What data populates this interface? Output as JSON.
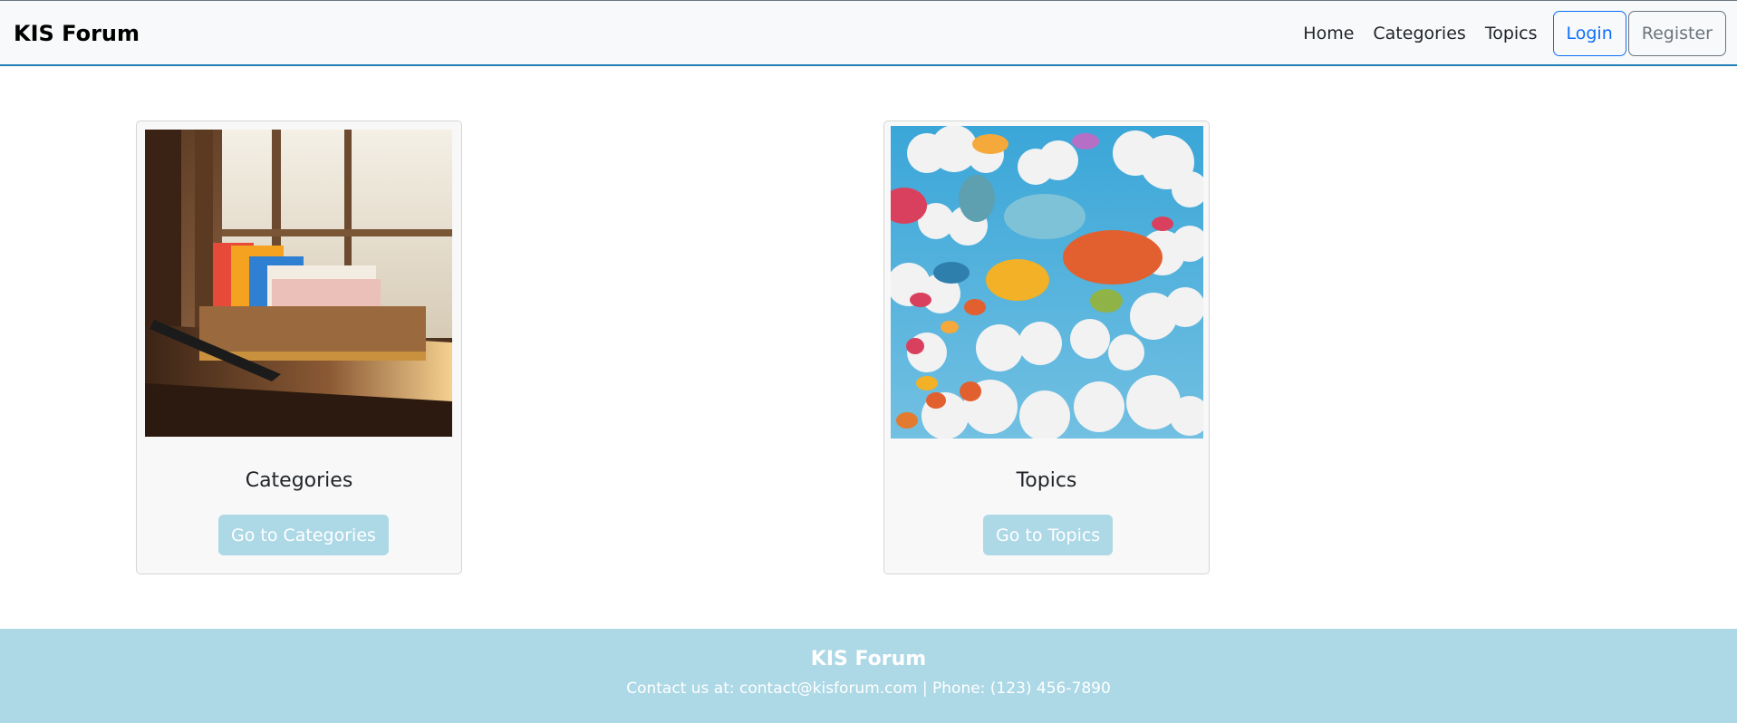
{
  "nav": {
    "brand": "KIS Forum",
    "links": [
      "Home",
      "Categories",
      "Topics"
    ],
    "login": "Login",
    "register": "Register"
  },
  "cards": [
    {
      "title": "Categories",
      "button": "Go to Categories",
      "image": "file-organizer-photo"
    },
    {
      "title": "Topics",
      "button": "Go to Topics",
      "image": "speech-bubbles-clouds-illustration"
    }
  ],
  "footer": {
    "title": "KIS Forum",
    "contact": "Contact us at: contact@kisforum.com | Phone: (123) 456-7890"
  },
  "colors": {
    "accent": "#add8e6",
    "primary": "#0d6efd",
    "navbar_bg": "#f8f9fa",
    "navbar_border": "#1f7fb4"
  }
}
